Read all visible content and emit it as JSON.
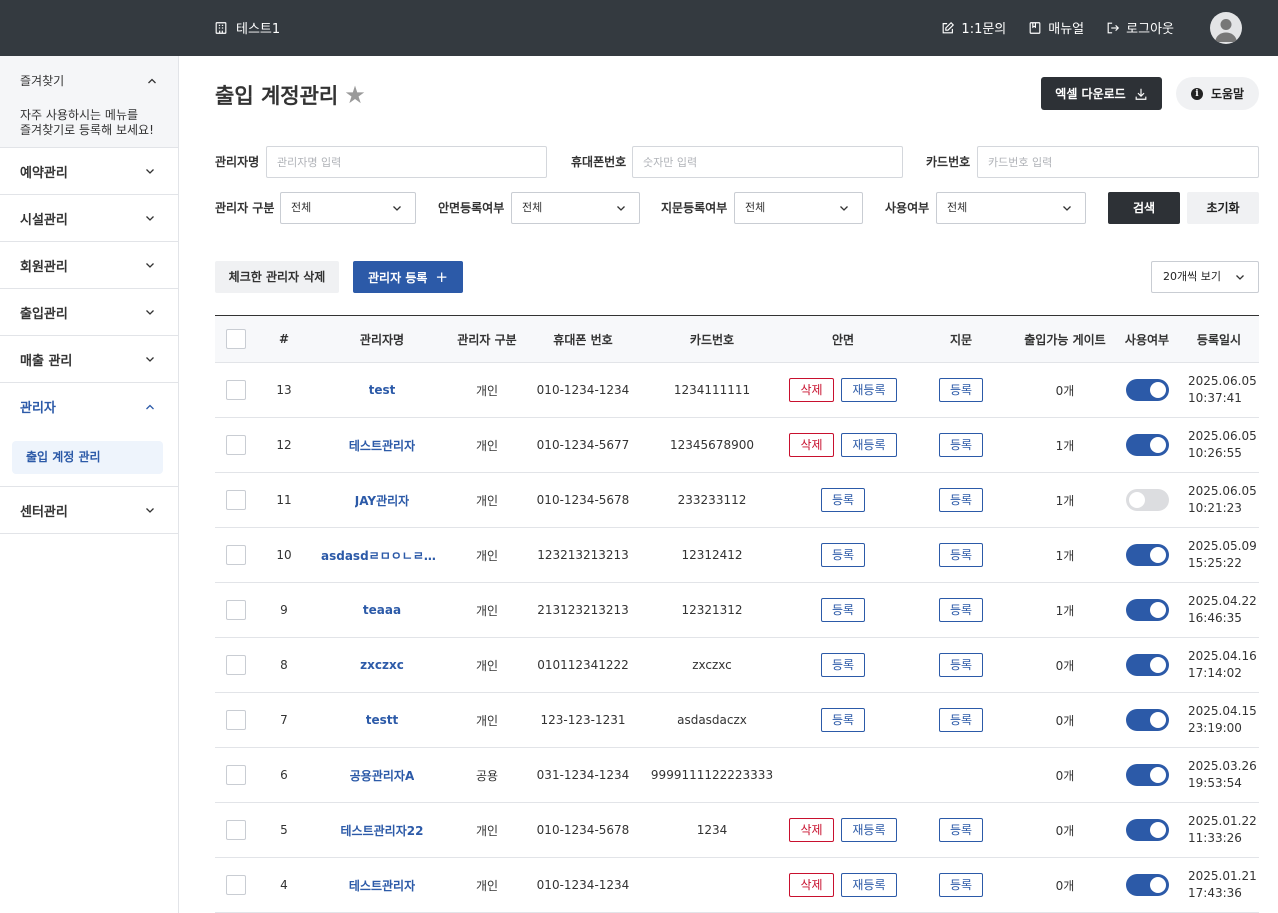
{
  "topbar": {
    "brand": "테스트1",
    "links": [
      {
        "label": "1:1문의",
        "icon": "edit-icon"
      },
      {
        "label": "매뉴얼",
        "icon": "book-icon"
      },
      {
        "label": "로그아웃",
        "icon": "logout-icon"
      }
    ]
  },
  "sidebar": {
    "favorites_title": "즐겨찾기",
    "favorites_msg_1": "자주 사용하시는 메뉴를",
    "favorites_msg_2": "즐겨찾기로 등록해 보세요!",
    "items": [
      {
        "label": "예약관리"
      },
      {
        "label": "시설관리"
      },
      {
        "label": "회원관리"
      },
      {
        "label": "출입관리"
      },
      {
        "label": "매출 관리"
      },
      {
        "label": "관리자"
      },
      {
        "label": "센터관리"
      }
    ],
    "subitem": "출입 계정 관리"
  },
  "page": {
    "title": "출입 계정관리",
    "excel_button": "엑셀 다운로드",
    "help_button": "도움말"
  },
  "filters": {
    "name_label": "관리자명",
    "name_placeholder": "관리자명 입력",
    "phone_label": "휴대폰번호",
    "phone_placeholder": "숫자만 입력",
    "card_label": "카드번호",
    "card_placeholder": "카드번호 입력",
    "type_label": "관리자 구분",
    "type_value": "전체",
    "face_label": "안면등록여부",
    "face_value": "전체",
    "finger_label": "지문등록여부",
    "finger_value": "전체",
    "use_label": "사용여부",
    "use_value": "전체",
    "search_button": "검색",
    "reset_button": "초기화"
  },
  "actions": {
    "delete_checked": "체크한 관리자 삭제",
    "register": "관리자 등록",
    "register_plus": "+",
    "page_size": "20개씩 보기"
  },
  "table": {
    "headers": [
      "#",
      "관리자명",
      "관리자 구분",
      "휴대폰 번호",
      "카드번호",
      "안면",
      "지문",
      "출입가능 게이트",
      "사용여부",
      "등록일시"
    ],
    "btn_delete": "삭제",
    "btn_reregister": "재등록",
    "btn_register": "등록",
    "rows": [
      {
        "no": "13",
        "name": "test",
        "type": "개인",
        "phone": "010-1234-1234",
        "card": "1234111111",
        "face": "registered",
        "finger": "register",
        "gates": "0개",
        "enabled": true,
        "date": "2025.06.05",
        "time": "10:37:41"
      },
      {
        "no": "12",
        "name": "테스트관리자",
        "type": "개인",
        "phone": "010-1234-5677",
        "card": "12345678900",
        "face": "registered",
        "finger": "register",
        "gates": "1개",
        "enabled": true,
        "date": "2025.06.05",
        "time": "10:26:55"
      },
      {
        "no": "11",
        "name": "JAY관리자",
        "type": "개인",
        "phone": "010-1234-5678",
        "card": "233233112",
        "face": "register",
        "finger": "register",
        "gates": "1개",
        "enabled": false,
        "date": "2025.06.05",
        "time": "10:21:23"
      },
      {
        "no": "10",
        "name": "asdasdㄹㅁㅇㄴㄹㅁ...",
        "type": "개인",
        "phone": "123213213213",
        "card": "12312412",
        "face": "register",
        "finger": "register",
        "gates": "1개",
        "enabled": true,
        "date": "2025.05.09",
        "time": "15:25:22"
      },
      {
        "no": "9",
        "name": "teaaa",
        "type": "개인",
        "phone": "213123213213",
        "card": "12321312",
        "face": "register",
        "finger": "register",
        "gates": "1개",
        "enabled": true,
        "date": "2025.04.22",
        "time": "16:46:35"
      },
      {
        "no": "8",
        "name": "zxczxc",
        "type": "개인",
        "phone": "010112341222",
        "card": "zxczxc",
        "face": "register",
        "finger": "register",
        "gates": "0개",
        "enabled": true,
        "date": "2025.04.16",
        "time": "17:14:02"
      },
      {
        "no": "7",
        "name": "testt",
        "type": "개인",
        "phone": "123-123-1231",
        "card": "asdasdaczx",
        "face": "register",
        "finger": "register",
        "gates": "0개",
        "enabled": true,
        "date": "2025.04.15",
        "time": "23:19:00"
      },
      {
        "no": "6",
        "name": "공용관리자A",
        "type": "공용",
        "phone": "031-1234-1234",
        "card": "9999111122223333",
        "face": "none",
        "finger": "none",
        "gates": "0개",
        "enabled": true,
        "date": "2025.03.26",
        "time": "19:53:54"
      },
      {
        "no": "5",
        "name": "테스트관리자22",
        "type": "개인",
        "phone": "010-1234-5678",
        "card": "1234",
        "face": "registered",
        "finger": "register",
        "gates": "0개",
        "enabled": true,
        "date": "2025.01.22",
        "time": "11:33:26"
      },
      {
        "no": "4",
        "name": "테스트관리자",
        "type": "개인",
        "phone": "010-1234-1234",
        "card": "",
        "face": "registered",
        "finger": "register",
        "gates": "0개",
        "enabled": true,
        "date": "2025.01.21",
        "time": "17:43:36"
      }
    ]
  },
  "colors": {
    "topbar_bg": "#343a40",
    "accent": "#2c5aa8",
    "danger": "#c8102e"
  }
}
